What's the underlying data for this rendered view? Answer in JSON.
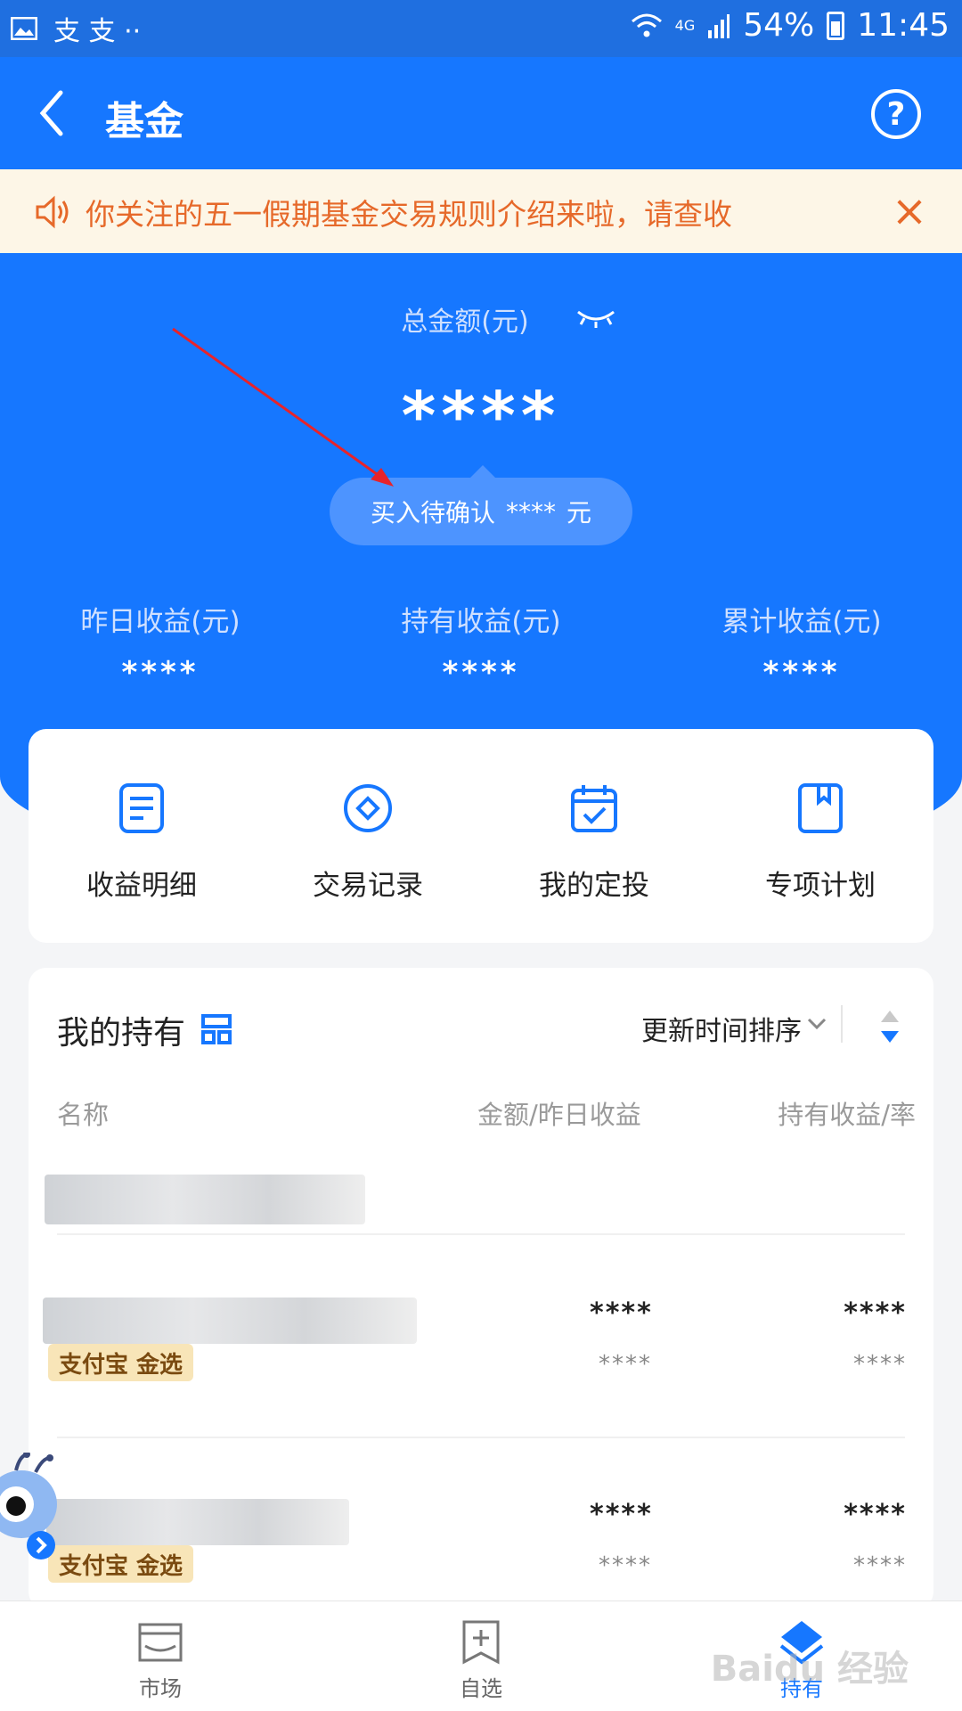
{
  "status_bar": {
    "time": "11:45",
    "battery": "54%",
    "network": "4G",
    "left_glyphs": "支 支 ··"
  },
  "header": {
    "title": "基金"
  },
  "notice": {
    "text": "你关注的五一假期基金交易规则介绍来啦，请查收"
  },
  "summary": {
    "total_label": "总金额(元)",
    "total_value": "****",
    "pending_prefix": "买入待确认",
    "pending_value": "****",
    "pending_suffix": "元",
    "stats": [
      {
        "label": "昨日收益(元)",
        "value": "****"
      },
      {
        "label": "持有收益(元)",
        "value": "****"
      },
      {
        "label": "累计收益(元)",
        "value": "****"
      }
    ]
  },
  "actions": [
    {
      "label": "收益明细",
      "icon": "document-icon"
    },
    {
      "label": "交易记录",
      "icon": "diamond-circle-icon"
    },
    {
      "label": "我的定投",
      "icon": "calendar-check-icon"
    },
    {
      "label": "专项计划",
      "icon": "bookmark-icon"
    }
  ],
  "holdings": {
    "title": "我的持有",
    "sort_label": "更新时间排序",
    "columns": [
      "名称",
      "金额/昨日收益",
      "持有收益/率"
    ],
    "rows": [
      {
        "tag": "支付宝 金选",
        "amount": "****",
        "yesterday": "****",
        "profit": "****",
        "rate": "****"
      },
      {
        "tag": "支付宝 金选",
        "amount": "****",
        "yesterday": "****",
        "profit": "****",
        "rate": "****"
      }
    ]
  },
  "bottom_nav": [
    {
      "label": "市场"
    },
    {
      "label": "自选"
    },
    {
      "label": "持有"
    }
  ],
  "watermark": "Baidu 经验",
  "colors": {
    "brand_blue": "#1677ff",
    "notice_orange": "#e6692a",
    "notice_bg": "#fdf6e7",
    "tag_bg": "#f8e5b8"
  }
}
